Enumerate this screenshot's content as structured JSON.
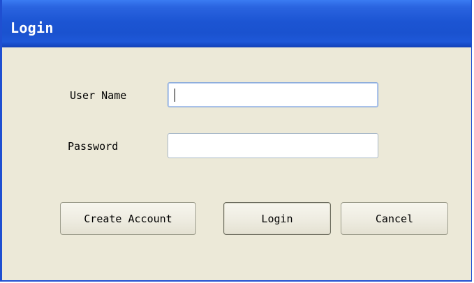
{
  "window": {
    "title": "Login"
  },
  "form": {
    "username_label": "User Name",
    "username_value": "",
    "password_label": "Password",
    "password_value": ""
  },
  "buttons": {
    "create_account": "Create Account",
    "login": "Login",
    "cancel": "Cancel"
  },
  "colors": {
    "titlebar": "#1c55d3",
    "dialog_background": "#ece9d8",
    "focused_input_border": "#7fa4dc"
  }
}
